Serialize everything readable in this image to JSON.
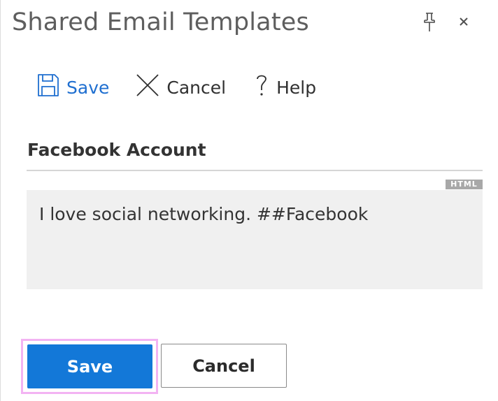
{
  "pane": {
    "title": "Shared Email Templates",
    "pin_icon": "pin-icon",
    "close_icon": "close-icon"
  },
  "toolbar": {
    "save_label": "Save",
    "save_icon": "floppy-disk-icon",
    "cancel_label": "Cancel",
    "cancel_icon": "x-icon",
    "help_label": "Help",
    "help_icon": "question-mark-icon"
  },
  "template": {
    "title": "Facebook Account",
    "format_badge": "HTML",
    "body": "I love social networking. ##Facebook"
  },
  "footer": {
    "save_label": "Save",
    "cancel_label": "Cancel"
  },
  "colors": {
    "accent": "#1378d8",
    "toolbar_save": "#1f6fd0",
    "focus_outline": "#f3b3f3",
    "body_background": "#f0f0f0"
  }
}
